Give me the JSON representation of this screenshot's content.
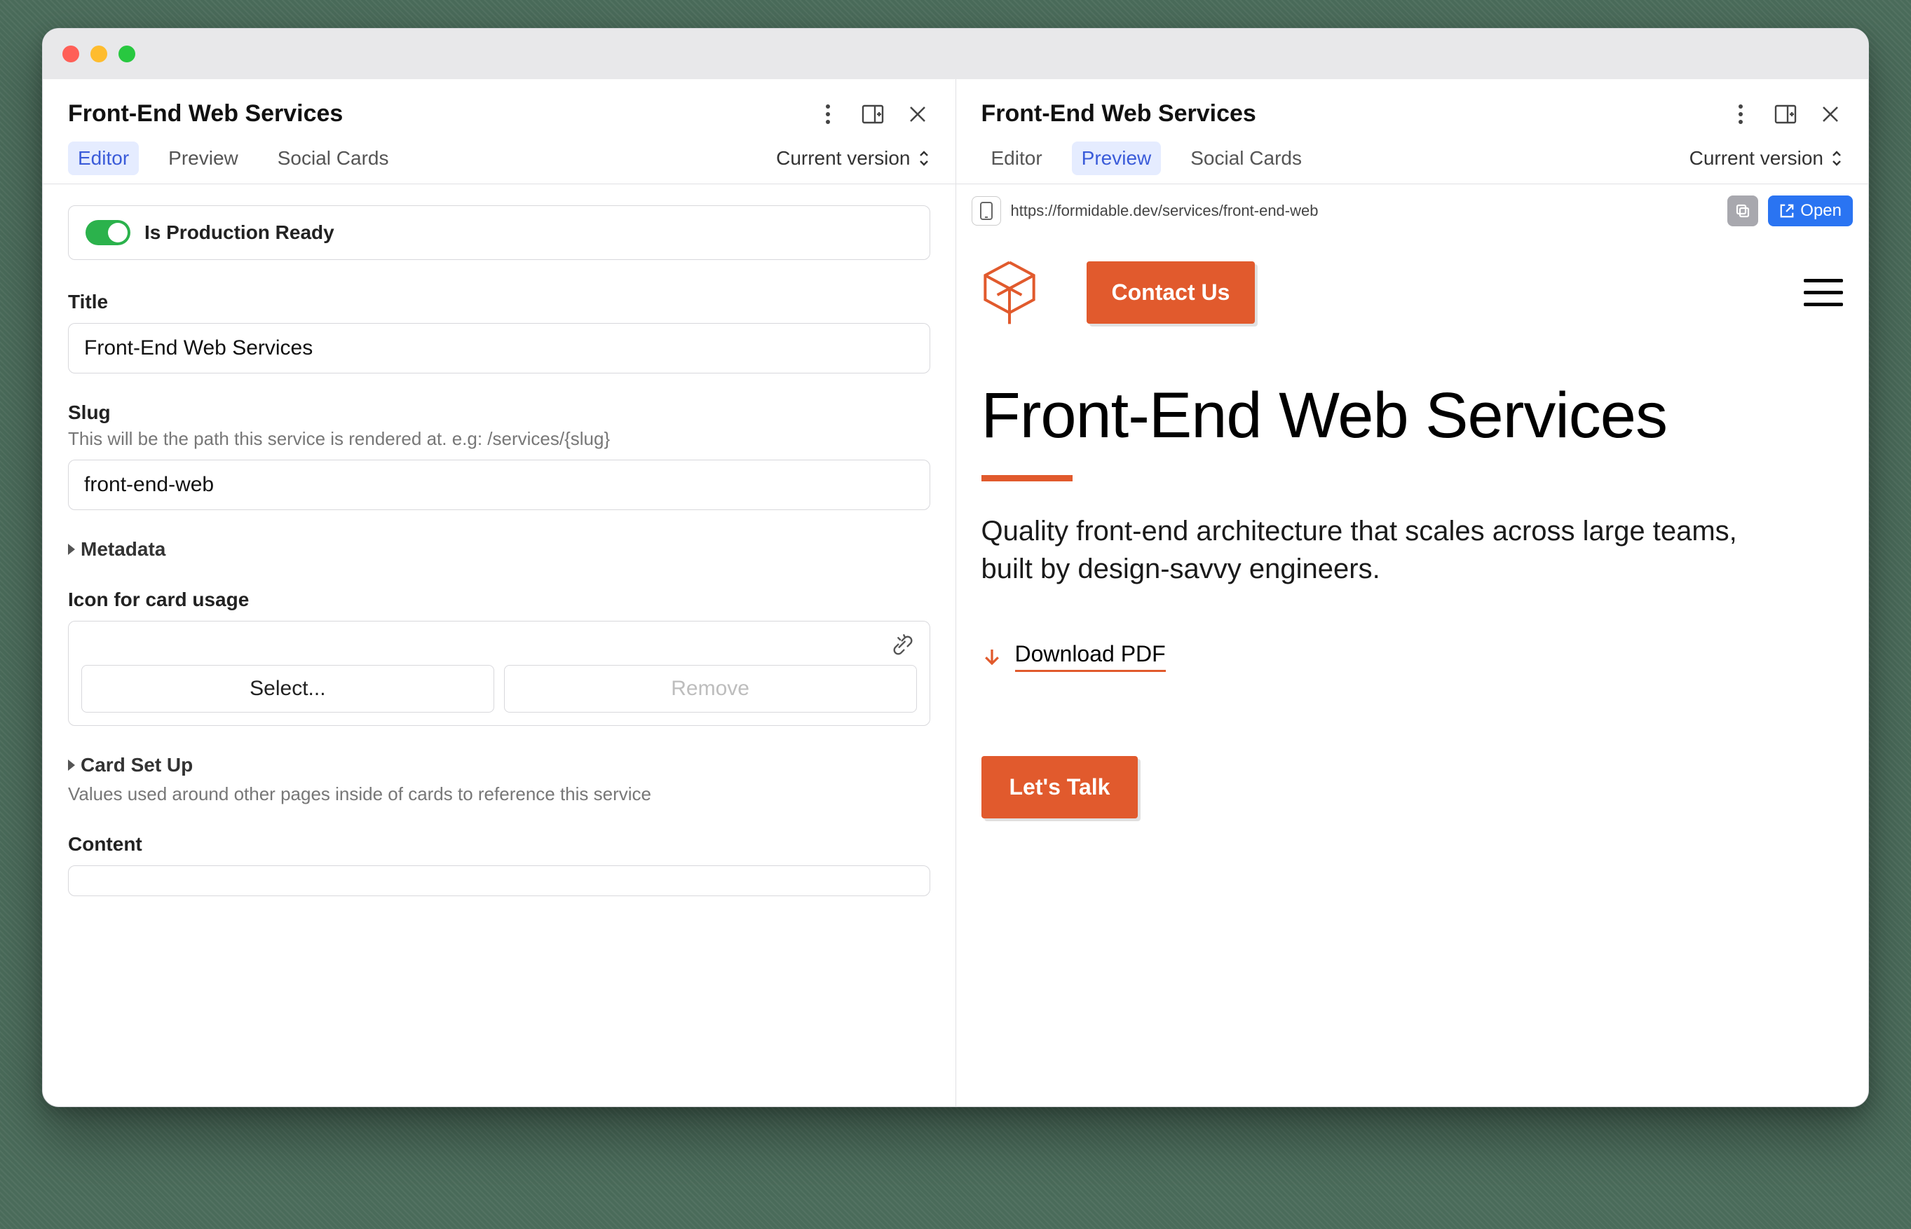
{
  "window": {
    "left": {
      "title": "Front-End Web Services",
      "tabs": [
        "Editor",
        "Preview",
        "Social Cards"
      ],
      "active_tab": 0,
      "version_label": "Current version",
      "fields": {
        "production_ready_label": "Is Production Ready",
        "production_ready": true,
        "title_label": "Title",
        "title_value": "Front-End Web Services",
        "slug_label": "Slug",
        "slug_help": "This will be the path this service is rendered at. e.g: /services/{slug}",
        "slug_value": "front-end-web",
        "metadata_label": "Metadata",
        "icon_label": "Icon for card usage",
        "icon_select": "Select...",
        "icon_remove": "Remove",
        "card_setup_label": "Card Set Up",
        "card_setup_help": "Values used around other pages inside of cards to reference this service",
        "content_label": "Content"
      }
    },
    "right": {
      "title": "Front-End Web Services",
      "tabs": [
        "Editor",
        "Preview",
        "Social Cards"
      ],
      "active_tab": 1,
      "version_label": "Current version",
      "url": "https://formidable.dev/services/front-end-web",
      "open_label": "Open",
      "preview": {
        "contact": "Contact Us",
        "hero_title": "Front-End Web Services",
        "hero_sub": "Quality front-end architecture that scales across large teams, built by design-savvy engineers.",
        "download": "Download PDF",
        "lets_talk": "Let's Talk"
      }
    }
  },
  "colors": {
    "accent": "#e15a2d",
    "blue": "#2a74f2",
    "green": "#2bb24c"
  }
}
